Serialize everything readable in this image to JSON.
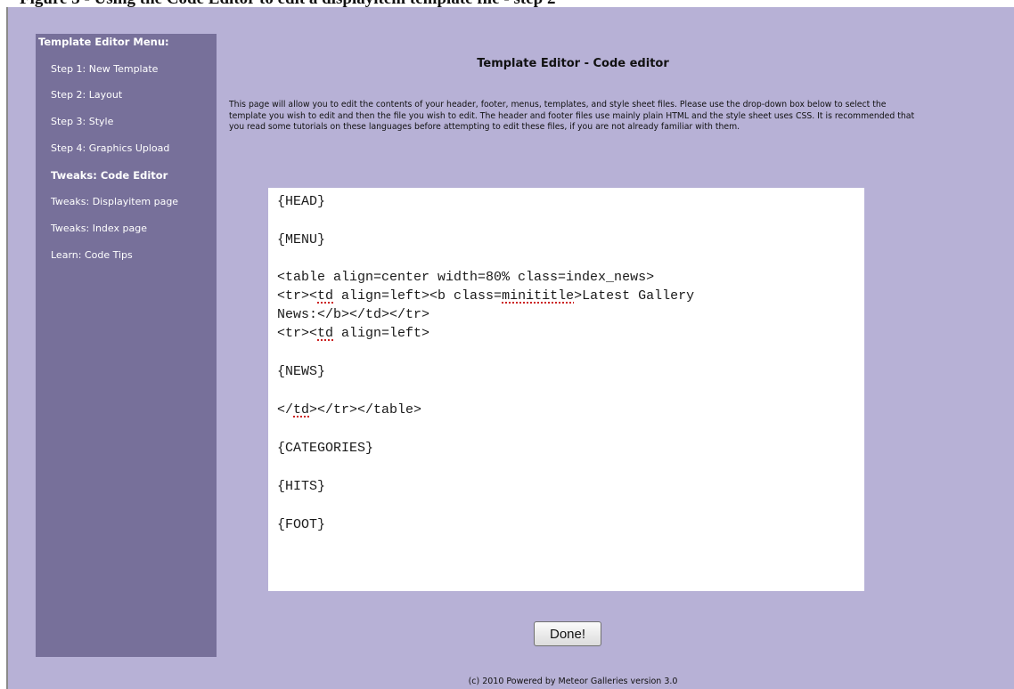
{
  "caption": "Figure 5 - Using the Code Editor to edit a displayitem template file - step 2",
  "sidebar": {
    "title": "Template Editor Menu:",
    "items": [
      {
        "label": "Step 1: New Template",
        "active": false
      },
      {
        "label": "Step 2: Layout",
        "active": false
      },
      {
        "label": "Step 3: Style",
        "active": false
      },
      {
        "label": "Step 4: Graphics Upload",
        "active": false
      },
      {
        "label": "Tweaks: Code Editor",
        "active": true
      },
      {
        "label": "Tweaks: Displayitem page",
        "active": false
      },
      {
        "label": "Tweaks: Index page",
        "active": false
      },
      {
        "label": "Learn: Code Tips",
        "active": false
      }
    ]
  },
  "main": {
    "title": "Template Editor - Code editor",
    "description": "This page will allow you to edit the contents of your header, footer, menus, templates, and style sheet files. Please use the drop-down box below to select the template you wish to edit and then the file you wish to edit. The header and footer files use mainly plain HTML and the style sheet uses CSS. It is recommended that you read some tutorials on these languages before attempting to edit these files, if you are not already familiar with them.",
    "editor": {
      "lines": [
        "{HEAD}",
        "{MENU}",
        "<table align=center width=80% class=index_news>",
        "<tr><td align=left><b class=minititle>Latest Gallery",
        "News:</b></td></tr>",
        "<tr><td align=left>",
        "{NEWS}",
        "</td></tr></table>",
        "{CATEGORIES}",
        "{HITS}",
        "{FOOT}"
      ]
    },
    "done_label": "Done!"
  },
  "footer": "(c) 2010 Powered by Meteor Galleries version 3.0",
  "colors": {
    "background": "#b7b1d6",
    "sidebar": "#77709a",
    "editor_bg": "#ffffff",
    "spellcheck_underline": "#cc2222"
  }
}
